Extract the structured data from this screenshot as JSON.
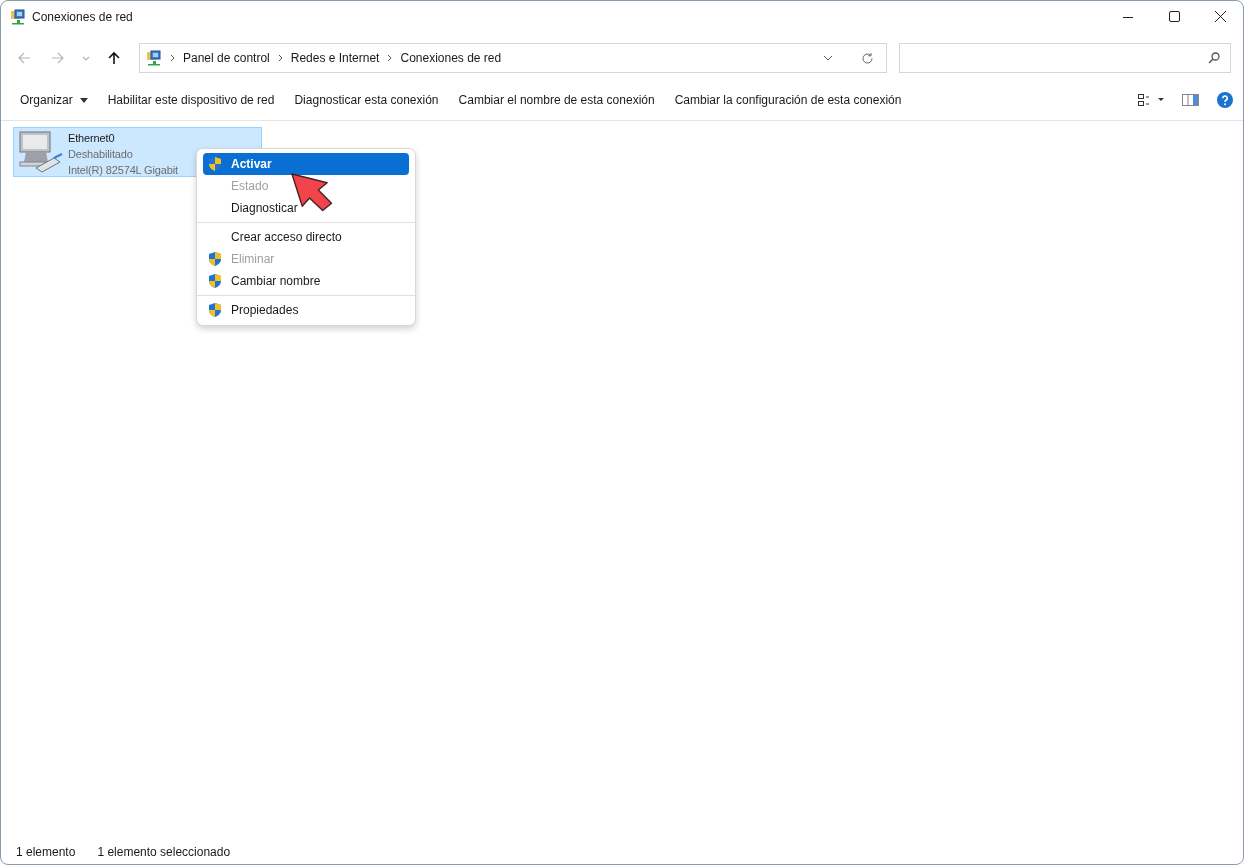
{
  "window": {
    "title": "Conexiones de red"
  },
  "navigation": [
    {
      "kind": "back",
      "disabled": true
    },
    {
      "kind": "forward",
      "disabled": true
    },
    {
      "kind": "recent",
      "disabled": true
    },
    {
      "kind": "up",
      "disabled": false
    }
  ],
  "address_bar": {
    "crumbs": [
      "Panel de control",
      "Redes e Internet",
      "Conexiones de red"
    ]
  },
  "commands": [
    {
      "label": "Organizar",
      "dropdown": true
    },
    {
      "label": "Habilitar este dispositivo de red",
      "dropdown": false
    },
    {
      "label": "Diagnosticar esta conexión",
      "dropdown": false
    },
    {
      "label": "Cambiar el nombre de esta conexión",
      "dropdown": false
    },
    {
      "label": "Cambiar la configuración de esta conexión",
      "dropdown": false
    }
  ],
  "items": [
    {
      "name": "Ethernet0",
      "status": "Deshabilitado",
      "device": "Intel(R) 82574L Gigabit",
      "selected": true
    }
  ],
  "context_menu": {
    "items": [
      {
        "kind": "item",
        "label": "Activar",
        "shield": true,
        "default": true,
        "disabled": false,
        "selected": true
      },
      {
        "kind": "item",
        "label": "Estado",
        "shield": false,
        "default": false,
        "disabled": true,
        "selected": false
      },
      {
        "kind": "item",
        "label": "Diagnosticar",
        "shield": false,
        "default": false,
        "disabled": false,
        "selected": false
      },
      {
        "kind": "separator"
      },
      {
        "kind": "item",
        "label": "Crear acceso directo",
        "shield": false,
        "default": false,
        "disabled": false,
        "selected": false
      },
      {
        "kind": "item",
        "label": "Eliminar",
        "shield": true,
        "default": false,
        "disabled": true,
        "selected": false
      },
      {
        "kind": "item",
        "label": "Cambiar nombre",
        "shield": true,
        "default": false,
        "disabled": false,
        "selected": false
      },
      {
        "kind": "separator"
      },
      {
        "kind": "item",
        "label": "Propiedades",
        "shield": true,
        "default": false,
        "disabled": false,
        "selected": false
      }
    ]
  },
  "status_bar": {
    "count": "1 elemento",
    "selection": "1 elemento seleccionado"
  }
}
